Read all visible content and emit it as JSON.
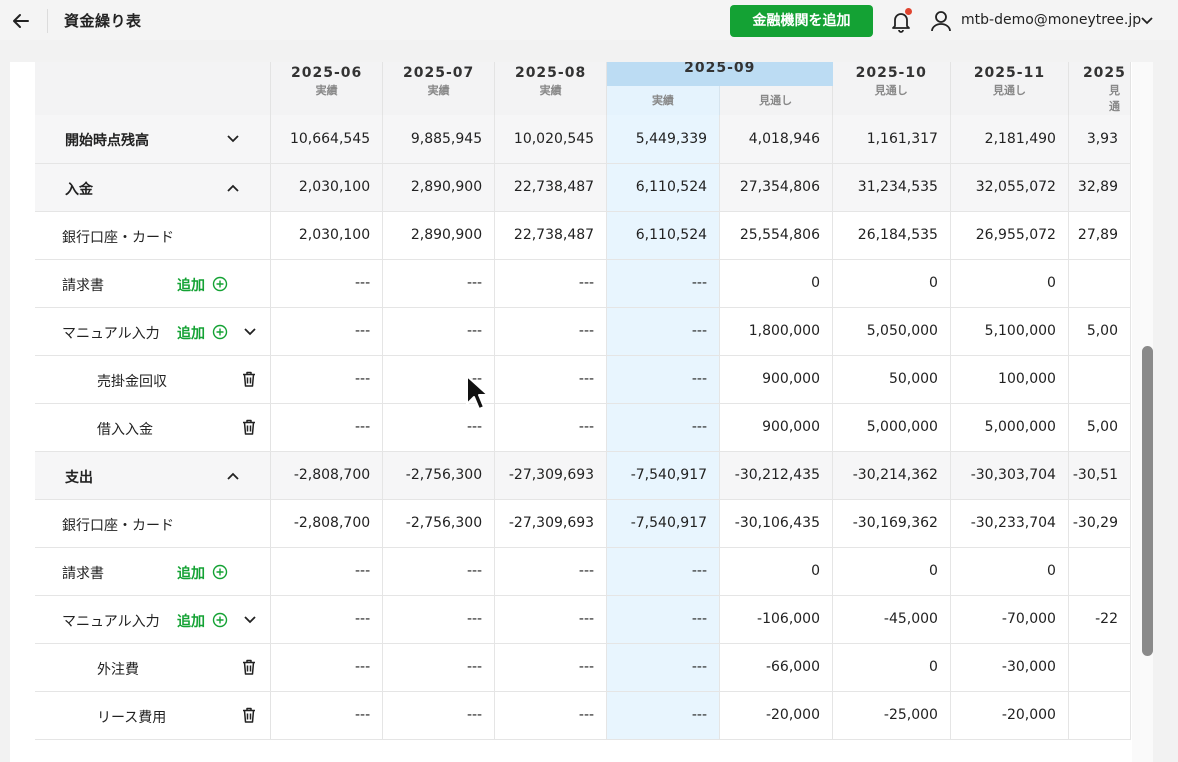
{
  "header": {
    "title": "資金繰り表",
    "add_bank_label": "金融機関を追加",
    "user_email": "mtb-demo@moneytree.jp"
  },
  "colors": {
    "brand_green": "#14a234",
    "highlight_blue": "#e8f5fe",
    "notification_dot": "#e0442f"
  },
  "columns": [
    {
      "month": "2025-06",
      "kind": "実績"
    },
    {
      "month": "2025-07",
      "kind": "実績"
    },
    {
      "month": "2025-08",
      "kind": "実績"
    },
    {
      "month": "2025-09",
      "kind": "実績"
    },
    {
      "month": "",
      "kind": "見通し"
    },
    {
      "month": "2025-10",
      "kind": "見通し"
    },
    {
      "month": "2025-11",
      "kind": "見通し"
    },
    {
      "month": "2025",
      "kind": "見通"
    }
  ],
  "add_label": "追加",
  "rows": [
    {
      "label": "開始時点残高",
      "values": [
        "10,664,545",
        "9,885,945",
        "10,020,545",
        "5,449,339",
        "4,018,946",
        "1,161,317",
        "2,181,490",
        "3,93"
      ]
    },
    {
      "label": "入金",
      "values": [
        "2,030,100",
        "2,890,900",
        "22,738,487",
        "6,110,524",
        "27,354,806",
        "31,234,535",
        "32,055,072",
        "32,89"
      ]
    },
    {
      "label": "銀行口座・カード",
      "values": [
        "2,030,100",
        "2,890,900",
        "22,738,487",
        "6,110,524",
        "25,554,806",
        "26,184,535",
        "26,955,072",
        "27,89"
      ]
    },
    {
      "label": "請求書",
      "values": [
        "---",
        "---",
        "---",
        "---",
        "0",
        "0",
        "0",
        ""
      ]
    },
    {
      "label": "マニュアル入力",
      "values": [
        "---",
        "---",
        "---",
        "---",
        "1,800,000",
        "5,050,000",
        "5,100,000",
        "5,00"
      ]
    },
    {
      "label": "売掛金回収",
      "values": [
        "---",
        "---",
        "---",
        "---",
        "900,000",
        "50,000",
        "100,000",
        ""
      ]
    },
    {
      "label": "借入入金",
      "values": [
        "---",
        "---",
        "---",
        "---",
        "900,000",
        "5,000,000",
        "5,000,000",
        "5,00"
      ]
    },
    {
      "label": "支出",
      "values": [
        "-2,808,700",
        "-2,756,300",
        "-27,309,693",
        "-7,540,917",
        "-30,212,435",
        "-30,214,362",
        "-30,303,704",
        "-30,51"
      ]
    },
    {
      "label": "銀行口座・カード",
      "values": [
        "-2,808,700",
        "-2,756,300",
        "-27,309,693",
        "-7,540,917",
        "-30,106,435",
        "-30,169,362",
        "-30,233,704",
        "-30,29"
      ]
    },
    {
      "label": "請求書",
      "values": [
        "---",
        "---",
        "---",
        "---",
        "0",
        "0",
        "0",
        ""
      ]
    },
    {
      "label": "マニュアル入力",
      "values": [
        "---",
        "---",
        "---",
        "---",
        "-106,000",
        "-45,000",
        "-70,000",
        "-22"
      ]
    },
    {
      "label": "外注費",
      "values": [
        "---",
        "---",
        "---",
        "---",
        "-66,000",
        "0",
        "-30,000",
        ""
      ]
    },
    {
      "label": "リース費用",
      "values": [
        "---",
        "---",
        "---",
        "---",
        "-20,000",
        "-25,000",
        "-20,000",
        ""
      ]
    }
  ]
}
